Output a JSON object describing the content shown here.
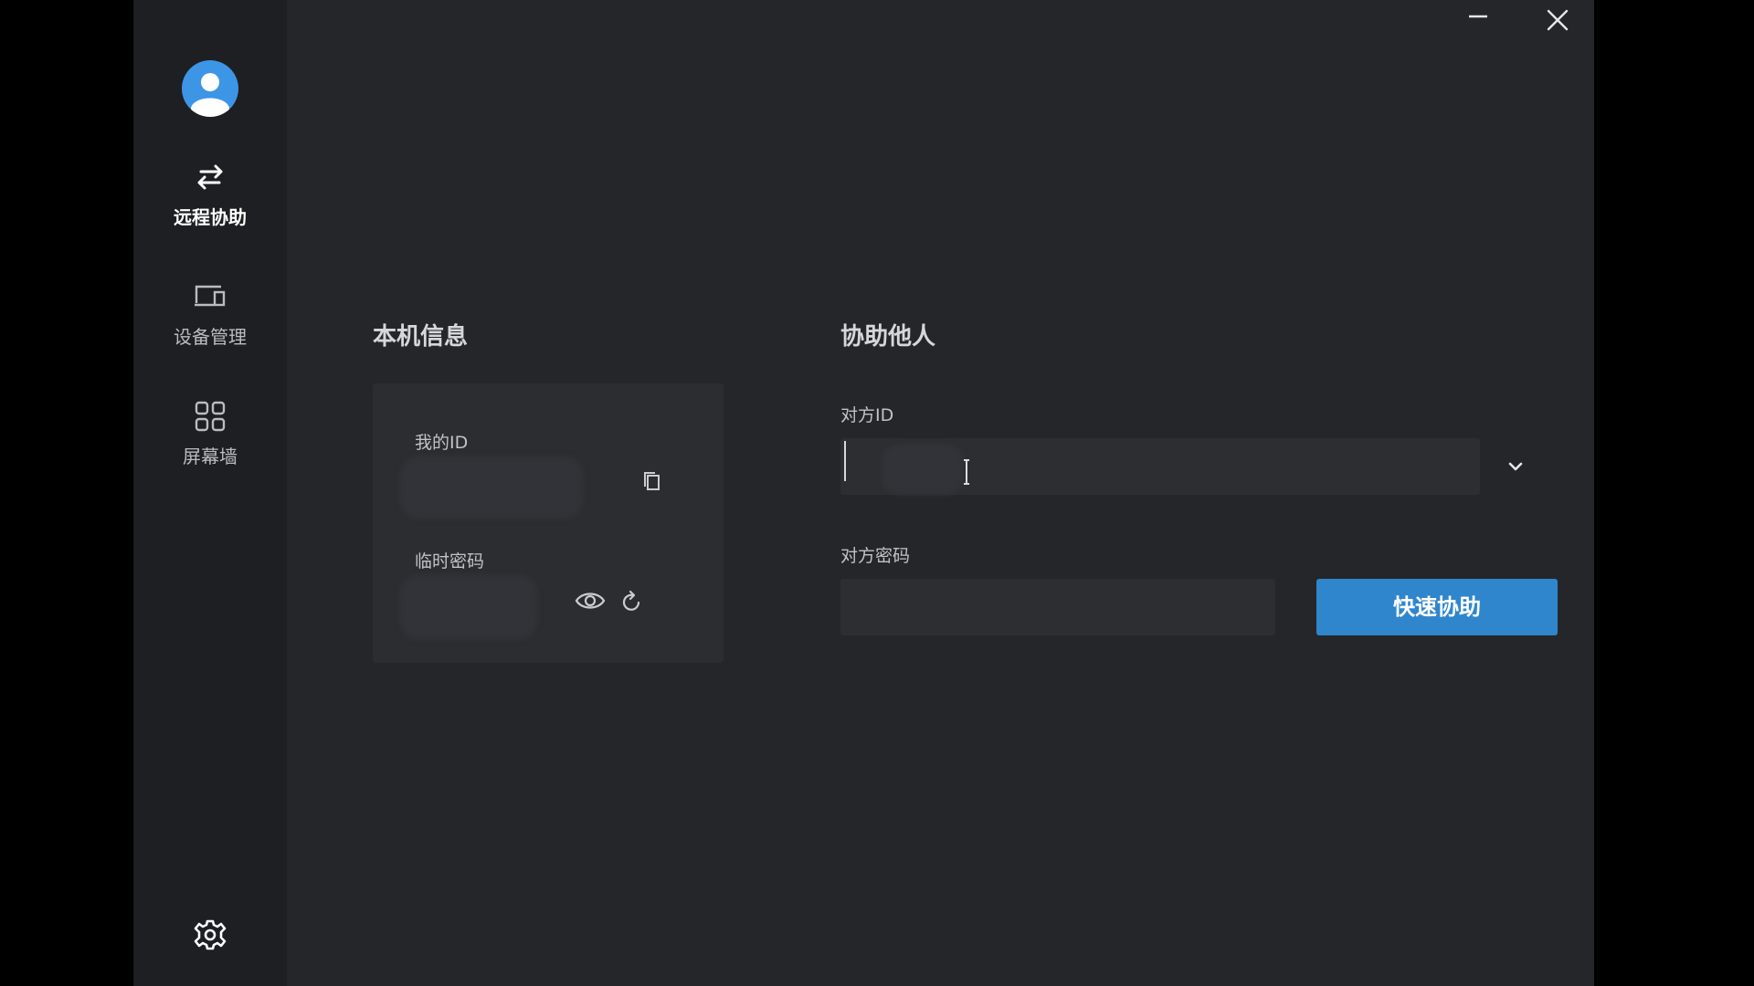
{
  "sidebar": {
    "avatar_icon": "user-avatar-icon",
    "items": [
      {
        "label": "远程协助",
        "icon": "swap-arrows-icon",
        "active": true
      },
      {
        "label": "设备管理",
        "icon": "devices-icon",
        "active": false
      },
      {
        "label": "屏幕墙",
        "icon": "grid-icon",
        "active": false
      }
    ],
    "settings_icon": "gear-icon"
  },
  "window_controls": {
    "minimize_icon": "minimize-icon",
    "close_icon": "close-icon"
  },
  "local_info": {
    "title": "本机信息",
    "my_id_label": "我的ID",
    "my_id_value": "",
    "temp_password_label": "临时密码",
    "temp_password_value": "",
    "copy_icon": "copy-icon",
    "show_password_icon": "eye-icon",
    "refresh_icon": "refresh-icon"
  },
  "assist_others": {
    "title": "协助他人",
    "peer_id_label": "对方ID",
    "peer_id_value": "",
    "peer_password_label": "对方密码",
    "peer_password_value": "",
    "dropdown_icon": "chevron-down-icon",
    "button_label": "快速协助"
  },
  "colors": {
    "accent": "#2f86cc",
    "avatar": "#3d95e6",
    "window_bg": "#24262a",
    "sidebar_bg": "#1e1f22",
    "card_bg": "#2b2d31"
  }
}
